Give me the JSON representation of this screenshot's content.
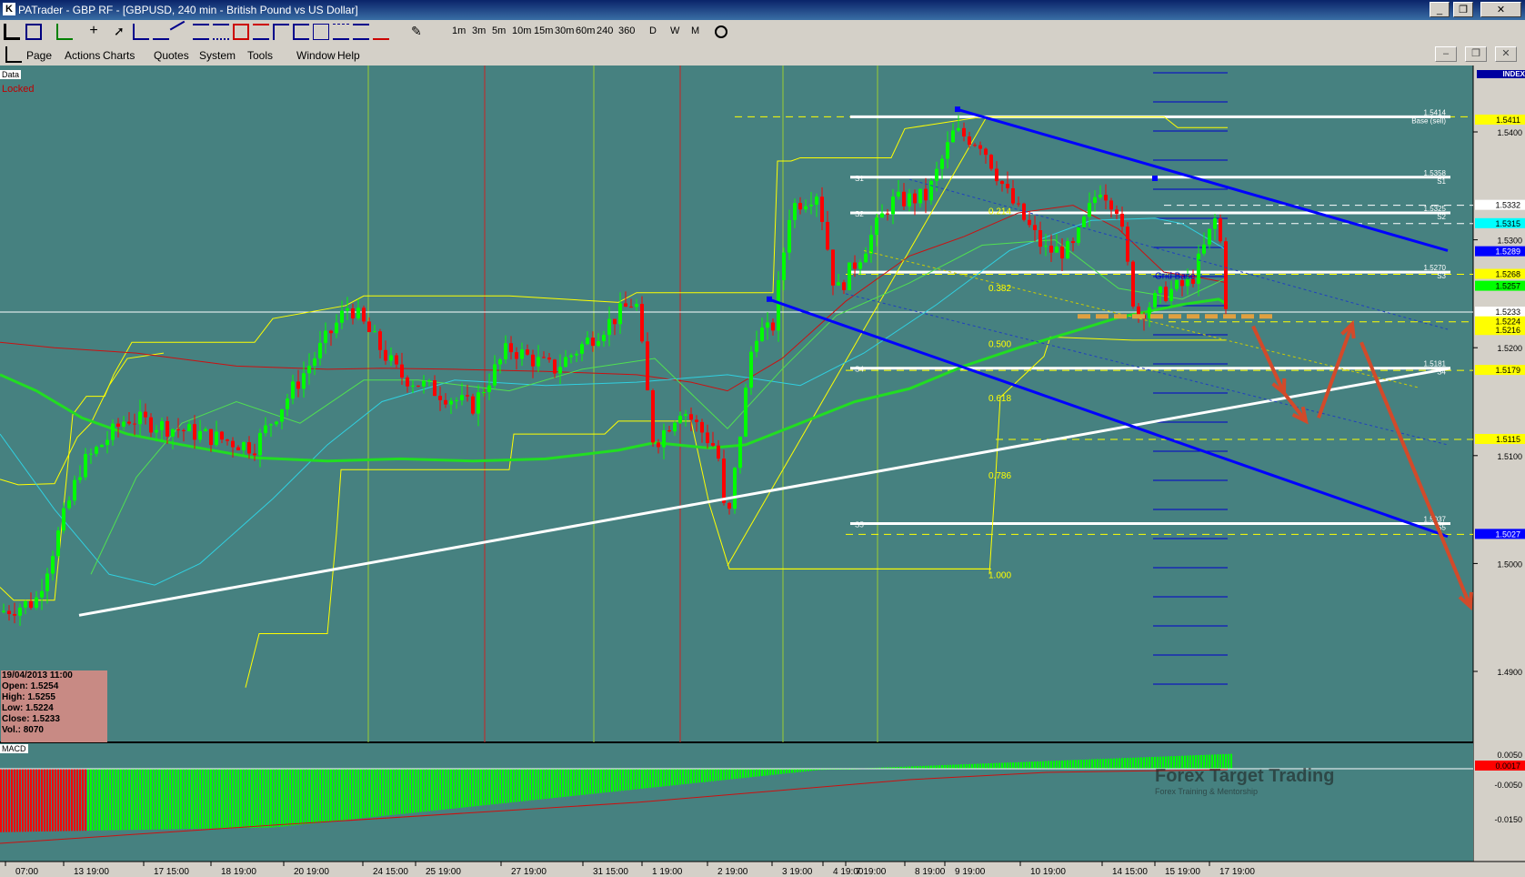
{
  "window": {
    "title": "PATrader - GBP RF - [GBPUSD, 240 min - British Pound vs US Dollar]",
    "app_icon": "K"
  },
  "toolbar": {
    "timeframes": [
      "1m",
      "3m",
      "5m",
      "10m",
      "15m",
      "30m",
      "60m",
      "240",
      "360"
    ],
    "periods": [
      "D",
      "W",
      "M"
    ]
  },
  "menu": [
    "Page",
    "Actions",
    "Charts",
    "Quotes",
    "System",
    "Tools",
    "Window",
    "Help"
  ],
  "chart": {
    "symbol": "GBPUSD",
    "interval": "240 min",
    "tags": {
      "data": "Data",
      "locked": "Locked",
      "index": "INDEX",
      "macd": "MACD"
    },
    "price_axis": [
      "1.5400",
      "1.5300",
      "1.5200",
      "1.5100",
      "1.5000",
      "1.4900"
    ],
    "price_markers": [
      {
        "label": "1.5411",
        "bg": "#ffff00",
        "fg": "#000000",
        "price": 1.5411
      },
      {
        "label": "1.5332",
        "bg": "#ffffff",
        "fg": "#000000",
        "price": 1.5332
      },
      {
        "label": "1.5315",
        "bg": "#00ffff",
        "fg": "#000000",
        "price": 1.5315
      },
      {
        "label": "1.5289",
        "bg": "#0000ff",
        "fg": "#ffffff",
        "price": 1.5289
      },
      {
        "label": "1.5268",
        "bg": "#ffff00",
        "fg": "#000000",
        "price": 1.5268
      },
      {
        "label": "1.5257",
        "bg": "#00ff00",
        "fg": "#000000",
        "price": 1.5257
      },
      {
        "label": "1.5233",
        "bg": "#ffffff",
        "fg": "#000000",
        "price": 1.5233
      },
      {
        "label": "1.5224",
        "bg": "#ffff00",
        "fg": "#000000",
        "price": 1.5224
      },
      {
        "label": "1.5216",
        "bg": "#ffff00",
        "fg": "#000000",
        "price": 1.5216
      },
      {
        "label": "1.5179",
        "bg": "#ffff00",
        "fg": "#000000",
        "price": 1.5179
      },
      {
        "label": "1.5115",
        "bg": "#ffff00",
        "fg": "#000000",
        "price": 1.5115
      },
      {
        "label": "1.5027",
        "bg": "#0000ff",
        "fg": "#ffffff",
        "price": 1.5027
      }
    ],
    "pivot_labels": [
      {
        "price": "1.5414",
        "name": "Base (sell)",
        "p": 1.5414
      },
      {
        "price": "1.5358",
        "name": "S1",
        "p": 1.5358
      },
      {
        "price": "1.5325",
        "name": "S2",
        "p": 1.5325
      },
      {
        "price": "1.5270",
        "name": "S3",
        "p": 1.527
      },
      {
        "price": "1.5181",
        "name": "S4",
        "p": 1.5181
      },
      {
        "price": "1.5037",
        "name": "S5",
        "p": 1.5037
      }
    ],
    "left_pivot_names": [
      {
        "name": "S1",
        "p": 1.5358
      },
      {
        "name": "S2",
        "p": 1.5325
      },
      {
        "name": "S4",
        "p": 1.5181
      },
      {
        "name": "S5",
        "p": 1.5037
      }
    ],
    "fib_levels": [
      {
        "label": "0.214",
        "p": 1.5327
      },
      {
        "label": "0.382",
        "p": 1.5256
      },
      {
        "label": "0.500",
        "p": 1.5204
      },
      {
        "label": "0.618",
        "p": 1.5154
      },
      {
        "label": "0.786",
        "p": 1.5082
      },
      {
        "label": "1.000",
        "p": 1.499
      }
    ],
    "grid_base_label": "Grid Base",
    "time_axis": [
      "07:00",
      "13 19:00",
      "17 15:00",
      "18 19:00",
      "20 19:00",
      "24 15:00",
      "25 19:00",
      "27 19:00",
      "31 15:00",
      "1 19:00",
      "2 19:00",
      "3 19:00",
      "4 19:00",
      "7 19:00",
      "8 19:00",
      "9 19:00",
      "10 19:00",
      "14 15:00",
      "15 19:00",
      "17 19:00"
    ],
    "macd_axis": [
      "0.0050",
      "-0.0050",
      "-0.0150"
    ],
    "macd_markers": [
      {
        "label": "0.0017",
        "bg": "#ff0000",
        "fg": "#000000"
      }
    ],
    "watermark": {
      "title": "Forex Target Trading",
      "subtitle": "Forex Training & Mentorship"
    }
  },
  "info_box": {
    "date": "19/04/2013 11:00",
    "open": "Open: 1.5254",
    "high": "High: 1.5255",
    "low": "Low: 1.5224",
    "close": "Close: 1.5233",
    "vol": "Vol.: 8070"
  },
  "colors": {
    "chart_bg": "#468180",
    "bull": "#00ff00",
    "bear": "#ff0000",
    "trend_blue": "#0000ff",
    "support_white": "#ffffff",
    "fib_yellow": "#ffff00",
    "projection": "#d24a2a"
  }
}
